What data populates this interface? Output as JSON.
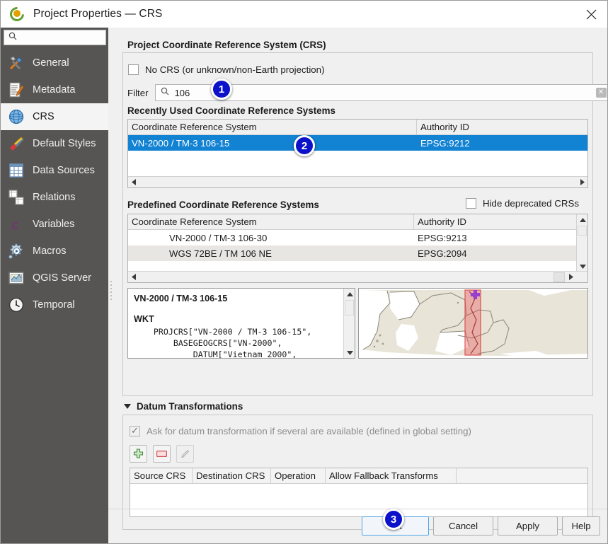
{
  "window": {
    "title": "Project Properties — CRS",
    "logo_icon": "qgis-logo-icon",
    "close_icon": "close-icon"
  },
  "sidebar": {
    "search_placeholder": "",
    "search_value": "",
    "search_icon": "search-icon",
    "items": [
      {
        "label": "General",
        "icon": "hammer-wrench-icon"
      },
      {
        "label": "Metadata",
        "icon": "document-pencil-icon"
      },
      {
        "label": "CRS",
        "icon": "globe-icon",
        "selected": true
      },
      {
        "label": "Default Styles",
        "icon": "paintbrush-icon"
      },
      {
        "label": "Data Sources",
        "icon": "table-icon"
      },
      {
        "label": "Relations",
        "icon": "relations-icon"
      },
      {
        "label": "Variables",
        "icon": "epsilon-icon"
      },
      {
        "label": "Macros",
        "icon": "gear-play-icon"
      },
      {
        "label": "QGIS Server",
        "icon": "server-map-icon"
      },
      {
        "label": "Temporal",
        "icon": "clock-icon"
      }
    ]
  },
  "crs_section": {
    "title": "Project Coordinate Reference System (CRS)",
    "no_crs": {
      "label": "No CRS (or unknown/non-Earth projection)",
      "checked": false
    },
    "filter": {
      "label": "Filter",
      "value": "106",
      "placeholder": "",
      "search_icon": "search-icon",
      "clear_icon": "clear-icon"
    },
    "recent": {
      "title": "Recently Used Coordinate Reference Systems",
      "columns": [
        "Coordinate Reference System",
        "Authority ID"
      ],
      "rows": [
        {
          "crs": "VN-2000 / TM-3 106-15",
          "authority": "EPSG:9212",
          "selected": true
        }
      ]
    },
    "predefined": {
      "title": "Predefined Coordinate Reference Systems",
      "hide_deprecated": {
        "label": "Hide deprecated CRSs",
        "checked": false
      },
      "columns": [
        "Coordinate Reference System",
        "Authority ID"
      ],
      "rows": [
        {
          "crs": "VN-2000 / TM-3 106-30",
          "authority": "EPSG:9213"
        },
        {
          "crs": "WGS 72BE / TM 106 NE",
          "authority": "EPSG:2094"
        }
      ]
    },
    "details": {
      "name": "VN-2000 / TM-3 106-15",
      "wkt_label": "WKT",
      "wkt_text": "    PROJCRS[\"VN-2000 / TM-3 106-15\",\n        BASEGEOGCRS[\"VN-2000\",\n            DATUM[\"Vietnam 2000\","
    }
  },
  "datum": {
    "title": "Datum Transformations",
    "collapse_icon": "chevron-down-icon",
    "ask_checkbox": {
      "label": "Ask for datum transformation if several are available (defined in global setting)",
      "checked": true
    },
    "toolbar": [
      {
        "name": "add-transform-button",
        "icon": "plus-icon",
        "enabled": true
      },
      {
        "name": "remove-transform-button",
        "icon": "minus-icon",
        "enabled": true
      },
      {
        "name": "edit-transform-button",
        "icon": "pencil-icon",
        "enabled": false
      }
    ],
    "columns": [
      "Source CRS",
      "Destination CRS",
      "Operation",
      "Allow Fallback Transforms"
    ],
    "rows": []
  },
  "buttons": {
    "ok": "OK",
    "cancel": "Cancel",
    "apply": "Apply",
    "help": "Help"
  },
  "annotations": [
    {
      "label": "1"
    },
    {
      "label": "2"
    },
    {
      "label": "3"
    }
  ],
  "colors": {
    "selection_blue": "#1282d2",
    "badge_blue": "#0b12c9",
    "sidebar_bg": "#575553",
    "panel_bg": "#f0f0f0"
  }
}
